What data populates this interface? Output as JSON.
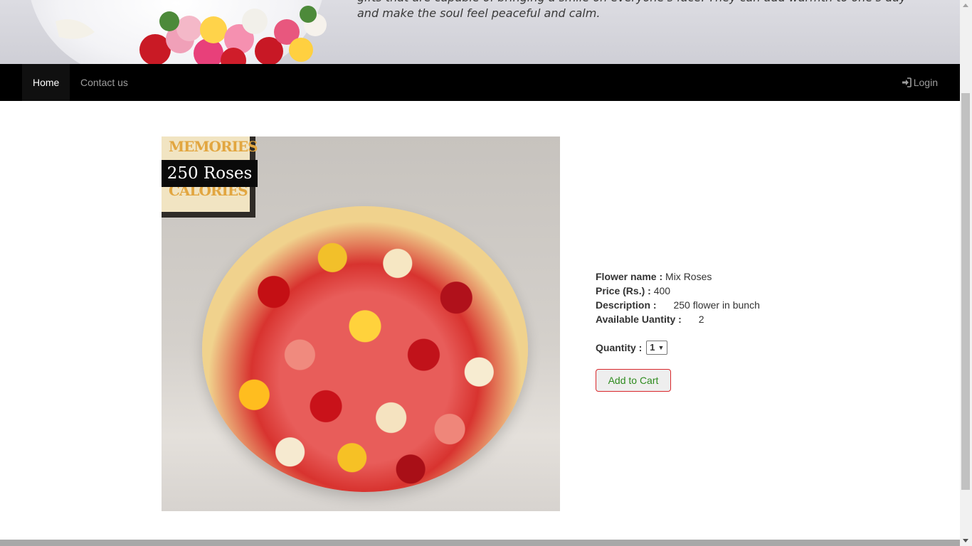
{
  "banner": {
    "text_line1": "gifts that are capable of bringing a smile on everyone's face. They can add warmth to one's day",
    "text_line2": "and make the soul feel peaceful and calm."
  },
  "navbar": {
    "items": [
      {
        "label": "Home",
        "active": true
      },
      {
        "label": "Contact us",
        "active": false
      }
    ],
    "login_label": "Login",
    "login_icon": "login-icon"
  },
  "product": {
    "image_badge": "250 Roses",
    "frame_words": [
      "MEMORIES",
      "CALORIES"
    ],
    "name_label": "Flower name :",
    "name_value": "Mix Roses",
    "price_label": "Price (Rs.) :",
    "price_value": "400",
    "description_label": "Description :",
    "description_value": "250 flower in bunch",
    "available_label": "Available Uantity :",
    "available_value": "2",
    "quantity_label": "Quantity :",
    "quantity_selected": "1",
    "add_to_cart_label": "Add to Cart"
  },
  "colors": {
    "navbar_bg": "#000000",
    "cart_border": "#d9282c",
    "cart_text": "#2e8b1e"
  }
}
